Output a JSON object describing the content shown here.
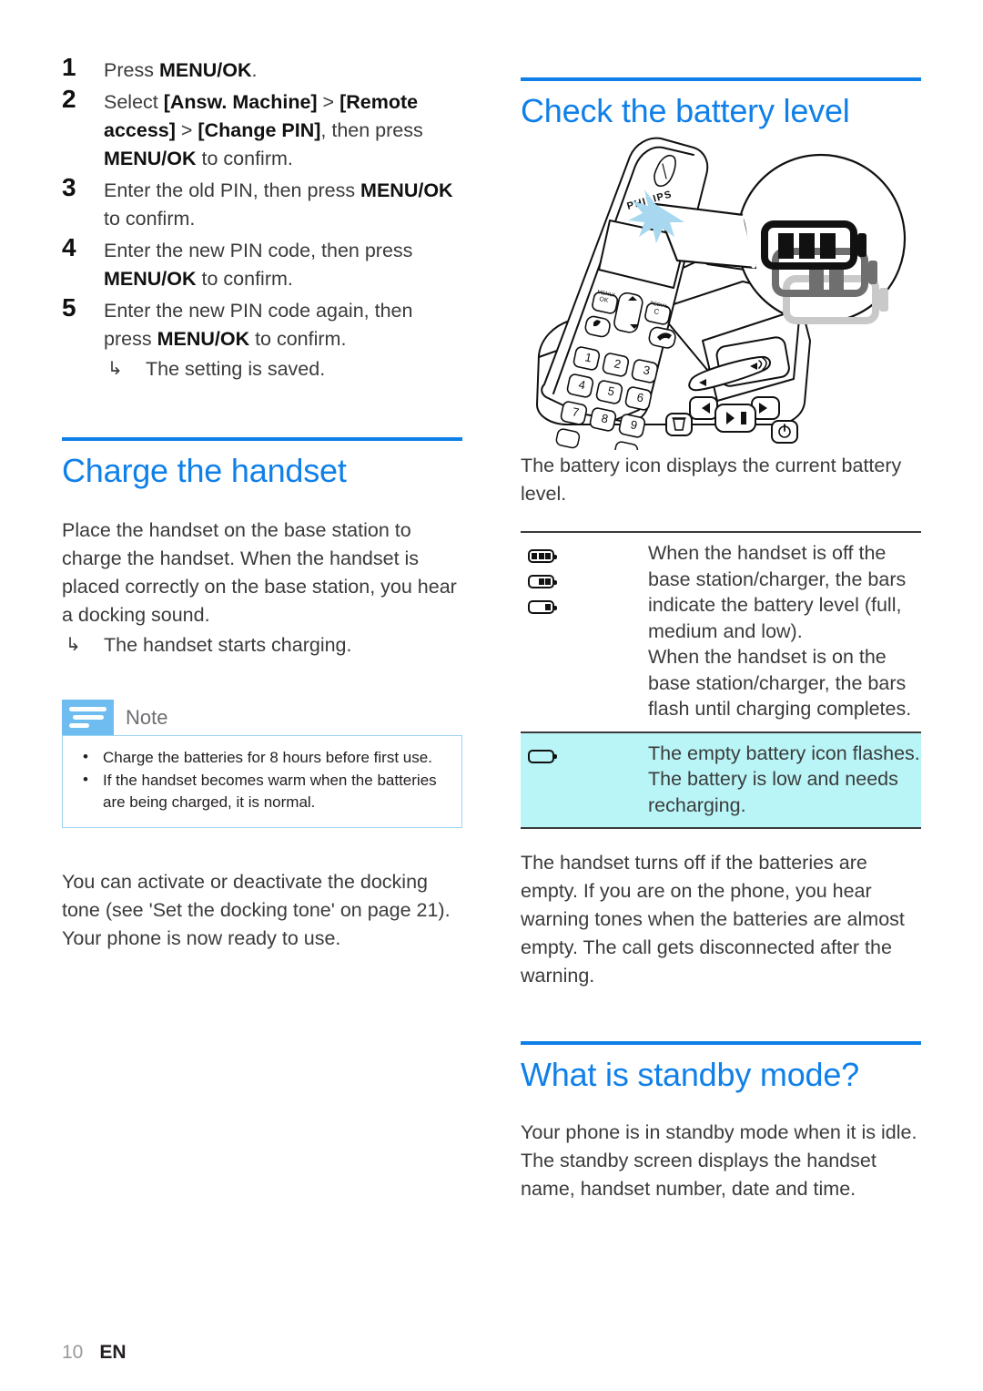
{
  "page": {
    "number": "10",
    "language": "EN"
  },
  "left_column": {
    "steps": [
      {
        "num": "1",
        "parts": [
          {
            "t": "Press ",
            "bold": false
          },
          {
            "t": "MENU/OK",
            "bold": true
          },
          {
            "t": ".",
            "bold": false
          }
        ]
      },
      {
        "num": "2",
        "parts": [
          {
            "t": "Select ",
            "bold": false
          },
          {
            "t": "[Answ. Machine]",
            "bold": true
          },
          {
            "t": " > ",
            "bold": false
          },
          {
            "t": "[Remote access]",
            "bold": true
          },
          {
            "t": " > ",
            "bold": false
          },
          {
            "t": "[Change PIN]",
            "bold": true
          },
          {
            "t": ", then press ",
            "bold": false
          },
          {
            "t": "MENU/OK",
            "bold": true
          },
          {
            "t": " to confirm.",
            "bold": false
          }
        ]
      },
      {
        "num": "3",
        "parts": [
          {
            "t": "Enter the old PIN, then press ",
            "bold": false
          },
          {
            "t": "MENU/OK",
            "bold": true
          },
          {
            "t": " to confirm.",
            "bold": false
          }
        ]
      },
      {
        "num": "4",
        "parts": [
          {
            "t": "Enter the new PIN code, then press ",
            "bold": false
          },
          {
            "t": "MENU/OK",
            "bold": true
          },
          {
            "t": " to confirm.",
            "bold": false
          }
        ]
      },
      {
        "num": "5",
        "parts": [
          {
            "t": "Enter the new PIN code again, then press ",
            "bold": false
          },
          {
            "t": "MENU/OK",
            "bold": true
          },
          {
            "t": " to confirm.",
            "bold": false
          }
        ]
      }
    ],
    "step_result": "The setting is saved.",
    "charge_section": {
      "heading": "Charge the handset",
      "paragraph": "Place the handset on the base station to charge the handset. When the handset is placed correctly on the base station, you hear a docking sound.",
      "result": "The handset starts charging."
    },
    "note": {
      "title": "Note",
      "items": [
        "Charge the batteries for 8 hours before first use.",
        "If the handset becomes warm when the batteries are being charged, it is normal."
      ]
    },
    "closing_paragraph": "You can activate or deactivate the docking tone (see 'Set the docking tone' on page 21). Your phone is now ready to use."
  },
  "right_column": {
    "battery_section": {
      "heading": "Check the battery level",
      "illustration_caption": "",
      "intro": "The battery icon displays the current battery level.",
      "table": [
        {
          "icons": [
            "battery-full-icon",
            "battery-medium-icon",
            "battery-low-icon"
          ],
          "icon_bars": [
            3,
            2,
            1
          ],
          "text": "When the handset is off the base station/charger, the bars indicate the battery level (full, medium and low).\nWhen the handset is on the base station/charger, the bars flash until charging completes.",
          "highlighted": false
        },
        {
          "icons": [
            "battery-empty-icon"
          ],
          "icon_bars": [
            0
          ],
          "text": "The empty battery icon flashes. The battery is low and needs recharging.",
          "highlighted": true
        }
      ],
      "outro": "The handset turns off if the batteries are empty. If you are on the phone, you hear warning tones when the batteries are almost empty. The call gets disconnected after the warning."
    },
    "standby_section": {
      "heading": "What is standby mode?",
      "paragraph": "Your phone is in standby mode when it is idle. The standby screen displays the handset name, handset number, date and time."
    }
  },
  "colors": {
    "heading_blue": "#1080e8",
    "rule_blue": "#0f7fe8",
    "note_tab_blue": "#6fbdf0",
    "note_border_blue": "#9ed4f2",
    "highlight_cyan": "#b9f5f7",
    "body_text": "#3b3b3b"
  },
  "icons": {
    "step_result_arrow": "↳"
  }
}
